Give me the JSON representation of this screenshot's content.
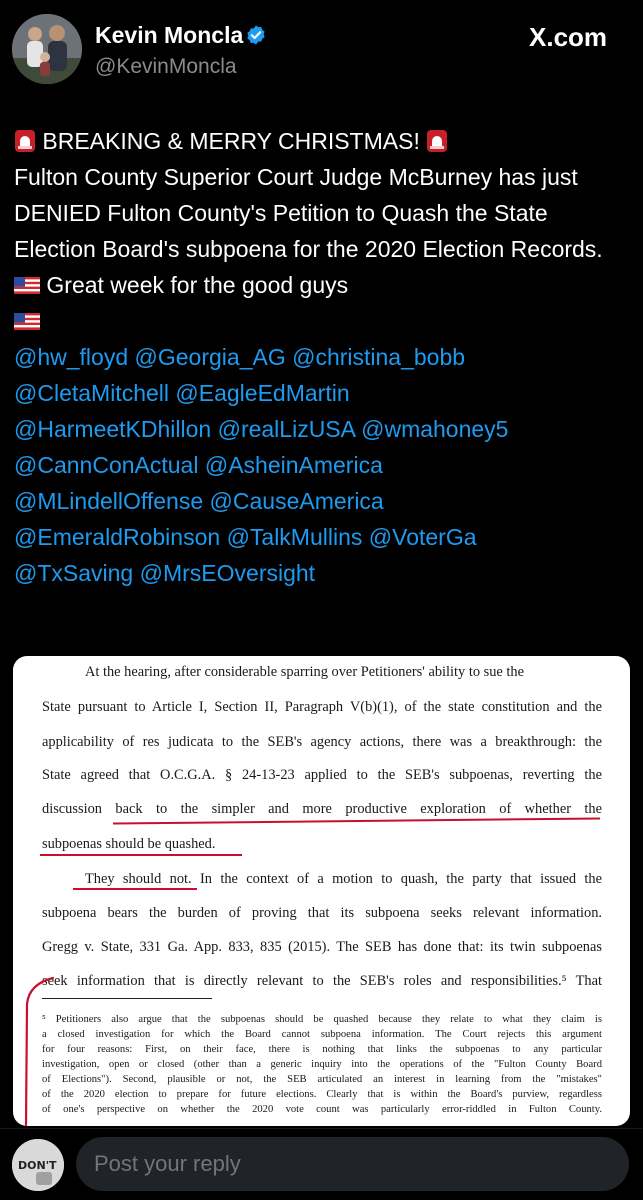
{
  "header": {
    "name": "Kevin Moncla",
    "handle": "@KevinMoncla",
    "brand": "X.com"
  },
  "tweet": {
    "heading": "BREAKING & MERRY CHRISTMAS!",
    "body_text": "Fulton County Superior Court Judge McBurney has just DENIED Fulton County's Petition to Quash the State Election Board's subpoena for the 2020 Election Records.",
    "closing_text": "Great week for the good guys",
    "mentions": [
      "@hw_floyd",
      "@Georgia_AG",
      "@christina_bobb",
      "@CletaMitchell",
      "@EagleEdMartin",
      "@HarmeetKDhillon",
      "@realLizUSA",
      "@wmahoney5",
      "@CannConActual",
      "@AsheinAmerica",
      "@MLindellOffense",
      "@CauseAmerica",
      "@EmeraldRobinson",
      "@TalkMullins",
      "@VoterGa",
      "@TxSaving",
      "@MrsEOversight"
    ]
  },
  "document": {
    "lines": [
      "At the hearing, after considerable sparring over Petitioners' ability to sue the",
      "State pursuant to Article I, Section II, Paragraph V(b)(1), of the state constitution and the",
      "applicability of res judicata to the SEB's agency actions, there was a breakthrough: the",
      "State agreed that O.C.G.A. § 24-13-23 applied to the SEB's subpoenas, reverting the",
      "discussion back to the simpler and more productive exploration of whether the",
      "subpoenas should be quashed.",
      "They should not.  In the context of a motion to quash, the party that issued the",
      "subpoena bears the burden of proving that its subpoena seeks relevant information.",
      "Gregg v. State, 331 Ga. App. 833, 835 (2015).  The SEB has done that: its twin subpoenas",
      "seek information that is directly relevant to the SEB's roles and responsibilities.⁵  That"
    ],
    "footnote": [
      "⁵ Petitioners also argue that the subpoenas should be quashed because they relate to what they claim is",
      "a closed investigation for which the Board cannot subpoena information.  The Court rejects this argument",
      "for four reasons: First, on their face, there is nothing that links the subpoenas to any particular",
      "investigation, open or closed (other than a generic inquiry into the operations of the \"Fulton County Board",
      "of Elections\").  Second, plausible or not, the SEB articulated an interest in learning from the \"mistakes\"",
      "of the 2020 election to prepare for future elections.  Clearly that is within the Board's purview, regardless",
      "of one's perspective on whether the 2020 vote count was particularly error-riddled in Fulton County."
    ]
  },
  "reply": {
    "placeholder": "Post your reply",
    "avatar_text": "DON'T"
  },
  "colors": {
    "background": "#000000",
    "mention": "#1d9bf0",
    "verified": "#1d9bf0",
    "annotation": "#c8102e"
  },
  "icons": [
    "verified-badge-icon",
    "x-logo-icon",
    "police-light-icon",
    "us-flag-icon"
  ]
}
